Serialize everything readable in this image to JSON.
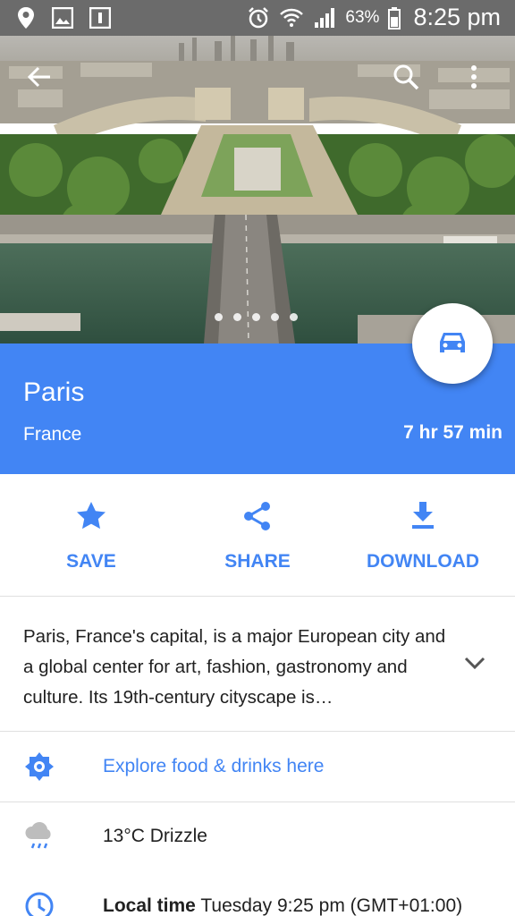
{
  "status_bar": {
    "battery": "63%",
    "time": "8:25 pm",
    "icons": [
      "location-pin-icon",
      "image-icon",
      "calendar-icon",
      "alarm-icon",
      "wifi-icon",
      "signal-icon",
      "battery-icon"
    ]
  },
  "hero": {
    "icons": [
      "back-arrow-icon",
      "search-icon",
      "more-vert-icon"
    ],
    "page_dots": 5,
    "active_dot": 1
  },
  "place": {
    "title": "Paris",
    "country": "France",
    "drive_time": "7 hr 57 min",
    "fab_icon": "car-icon"
  },
  "actions": [
    {
      "label": "SAVE",
      "icon": "star-icon"
    },
    {
      "label": "SHARE",
      "icon": "share-icon"
    },
    {
      "label": "DOWNLOAD",
      "icon": "download-icon"
    }
  ],
  "description": {
    "text": "Paris, France's capital, is a major European city and a global center for art, fashion, gastronomy and culture. Its 19th-century cityscape is…",
    "expand_icon": "chevron-down-icon"
  },
  "explore": {
    "label": "Explore food & drinks here",
    "icon": "explore-icon"
  },
  "weather": {
    "label": "13°C Drizzle",
    "icon": "drizzle-icon"
  },
  "local_time": {
    "prefix": "Local time",
    "value": "Tuesday 9:25 pm (GMT+01:00)",
    "icon": "clock-icon"
  },
  "colors": {
    "accent": "#4285f4",
    "status_bar": "#6b6b6b",
    "text": "#212121",
    "divider": "#e0e0e0"
  }
}
